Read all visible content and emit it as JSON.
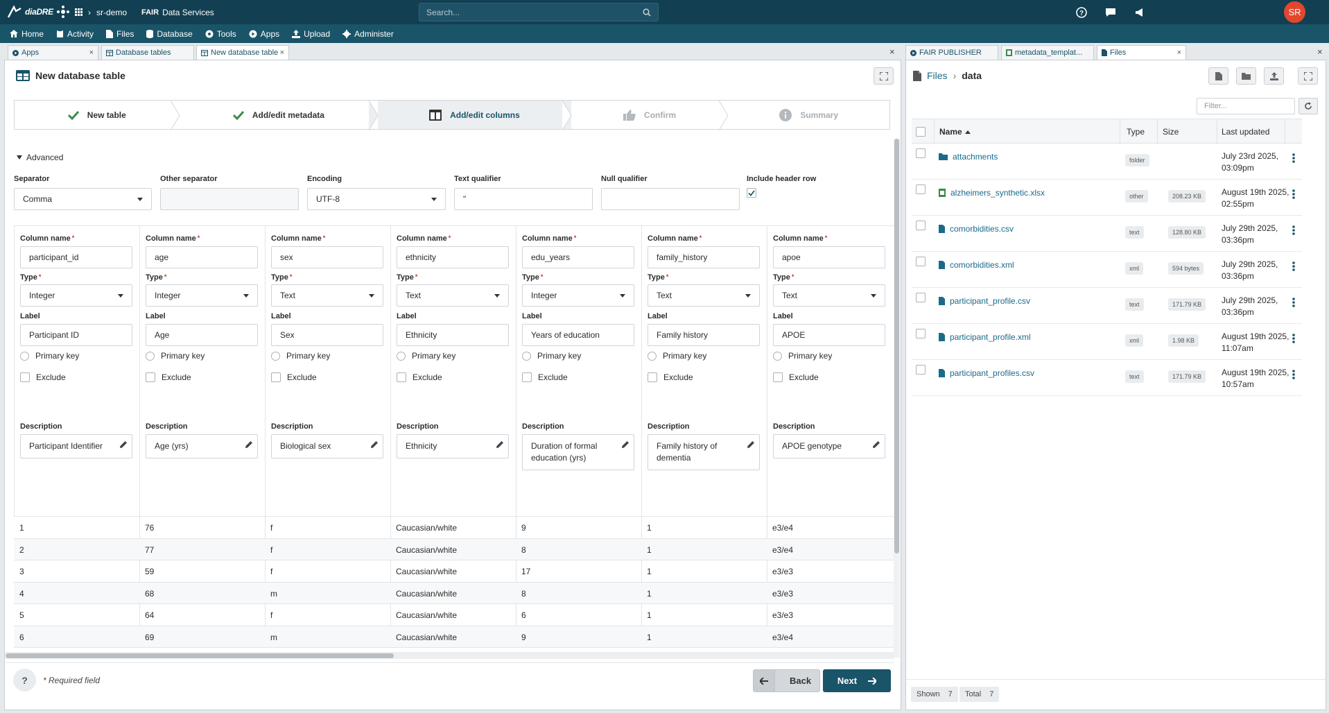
{
  "header": {
    "brand": "diaDRE",
    "project": "sr-demo",
    "fair_prefix": "FAIR",
    "fair_label": "Data Services",
    "search_placeholder": "Search...",
    "avatar_initials": "SR"
  },
  "nav": {
    "items": [
      {
        "label": "Home",
        "icon": "home-icon"
      },
      {
        "label": "Activity",
        "icon": "activity-icon"
      },
      {
        "label": "Files",
        "icon": "file-icon"
      },
      {
        "label": "Database",
        "icon": "database-icon"
      },
      {
        "label": "Tools",
        "icon": "tools-icon"
      },
      {
        "label": "Apps",
        "icon": "apps-icon"
      },
      {
        "label": "Upload",
        "icon": "upload-icon"
      },
      {
        "label": "Administer",
        "icon": "gear-icon"
      }
    ]
  },
  "left_tabs": [
    "Apps",
    "Database tables",
    "New database table"
  ],
  "right_tabs": [
    "FAIR PUBLISHER",
    "metadata_templat...",
    "Files"
  ],
  "wizard": {
    "title": "New database table",
    "steps": [
      {
        "label": "New table",
        "state": "done"
      },
      {
        "label": "Add/edit metadata",
        "state": "done"
      },
      {
        "label": "Add/edit columns",
        "state": "current"
      },
      {
        "label": "Confirm",
        "state": "disabled"
      },
      {
        "label": "Summary",
        "state": "disabled"
      }
    ],
    "advanced_label": "Advanced",
    "options": {
      "separator_label": "Separator",
      "separator_value": "Comma",
      "other_separator_label": "Other separator",
      "other_separator_value": "",
      "encoding_label": "Encoding",
      "encoding_value": "UTF-8",
      "text_qualifier_label": "Text qualifier",
      "text_qualifier_value": "\"",
      "null_qualifier_label": "Null qualifier",
      "null_qualifier_value": "",
      "include_header_label": "Include header row",
      "include_header_checked": true
    },
    "field_labels": {
      "column_name": "Column name",
      "type": "Type",
      "label": "Label",
      "primary_key": "Primary key",
      "exclude": "Exclude",
      "description": "Description"
    },
    "columns": [
      {
        "name": "participant_id",
        "type": "Integer",
        "label": "Participant ID",
        "description": "Participant Identifier"
      },
      {
        "name": "age",
        "type": "Integer",
        "label": "Age",
        "description": "Age (yrs)"
      },
      {
        "name": "sex",
        "type": "Text",
        "label": "Sex",
        "description": "Biological sex"
      },
      {
        "name": "ethnicity",
        "type": "Text",
        "label": "Ethnicity",
        "description": "Ethnicity"
      },
      {
        "name": "edu_years",
        "type": "Integer",
        "label": "Years of education",
        "description": "Duration of formal education (yrs)"
      },
      {
        "name": "family_history",
        "type": "Text",
        "label": "Family history",
        "description": "Family history of dementia"
      },
      {
        "name": "apoe",
        "type": "Text",
        "label": "APOE",
        "description": "APOE genotype"
      }
    ],
    "preview_rows": [
      [
        "1",
        "76",
        "f",
        "Caucasian/white",
        "9",
        "1",
        "e3/e4"
      ],
      [
        "2",
        "77",
        "f",
        "Caucasian/white",
        "8",
        "1",
        "e3/e4"
      ],
      [
        "3",
        "59",
        "f",
        "Caucasian/white",
        "17",
        "1",
        "e3/e3"
      ],
      [
        "4",
        "68",
        "m",
        "Caucasian/white",
        "8",
        "1",
        "e3/e3"
      ],
      [
        "5",
        "64",
        "f",
        "Caucasian/white",
        "6",
        "1",
        "e3/e3"
      ],
      [
        "6",
        "69",
        "m",
        "Caucasian/white",
        "9",
        "1",
        "e3/e4"
      ]
    ],
    "required_note": "* Required field",
    "help_label": "?",
    "back_label": "Back",
    "next_label": "Next"
  },
  "files": {
    "breadcrumb_root": "Files",
    "breadcrumb_current": "data",
    "filter_placeholder": "Filter...",
    "headers": {
      "name": "Name",
      "type": "Type",
      "size": "Size",
      "updated": "Last updated"
    },
    "rows": [
      {
        "name": "attachments",
        "icon": "folder-icon",
        "type": "folder",
        "size": "",
        "date1": "July 23rd 2025,",
        "date2": "03:09pm"
      },
      {
        "name": "alzheimers_synthetic.xlsx",
        "icon": "spreadsheet-icon",
        "type": "other",
        "size": "208.23 KB",
        "date1": "August 19th 2025,",
        "date2": "02:55pm"
      },
      {
        "name": "comorbidities.csv",
        "icon": "file-icon",
        "type": "text",
        "size": "128.80 KB",
        "date1": "July 29th 2025,",
        "date2": "03:36pm"
      },
      {
        "name": "comorbidities.xml",
        "icon": "file-icon",
        "type": "xml",
        "size": "594 bytes",
        "date1": "July 29th 2025,",
        "date2": "03:36pm"
      },
      {
        "name": "participant_profile.csv",
        "icon": "file-icon",
        "type": "text",
        "size": "171.79 KB",
        "date1": "July 29th 2025,",
        "date2": "03:36pm"
      },
      {
        "name": "participant_profile.xml",
        "icon": "file-icon",
        "type": "xml",
        "size": "1.98 KB",
        "date1": "August 19th 2025,",
        "date2": "11:07am"
      },
      {
        "name": "participant_profiles.csv",
        "icon": "file-icon",
        "type": "text",
        "size": "171.79 KB",
        "date1": "August 19th 2025,",
        "date2": "10:57am"
      }
    ],
    "shown_label": "Shown",
    "shown_value": "7",
    "total_label": "Total",
    "total_value": "7"
  },
  "colors": {
    "topbar": "#123f52",
    "navbar": "#1a5468",
    "accent": "#1a5468",
    "link": "#1a6a8a",
    "avatar": "#e2472e",
    "check": "#3a8a4a"
  }
}
